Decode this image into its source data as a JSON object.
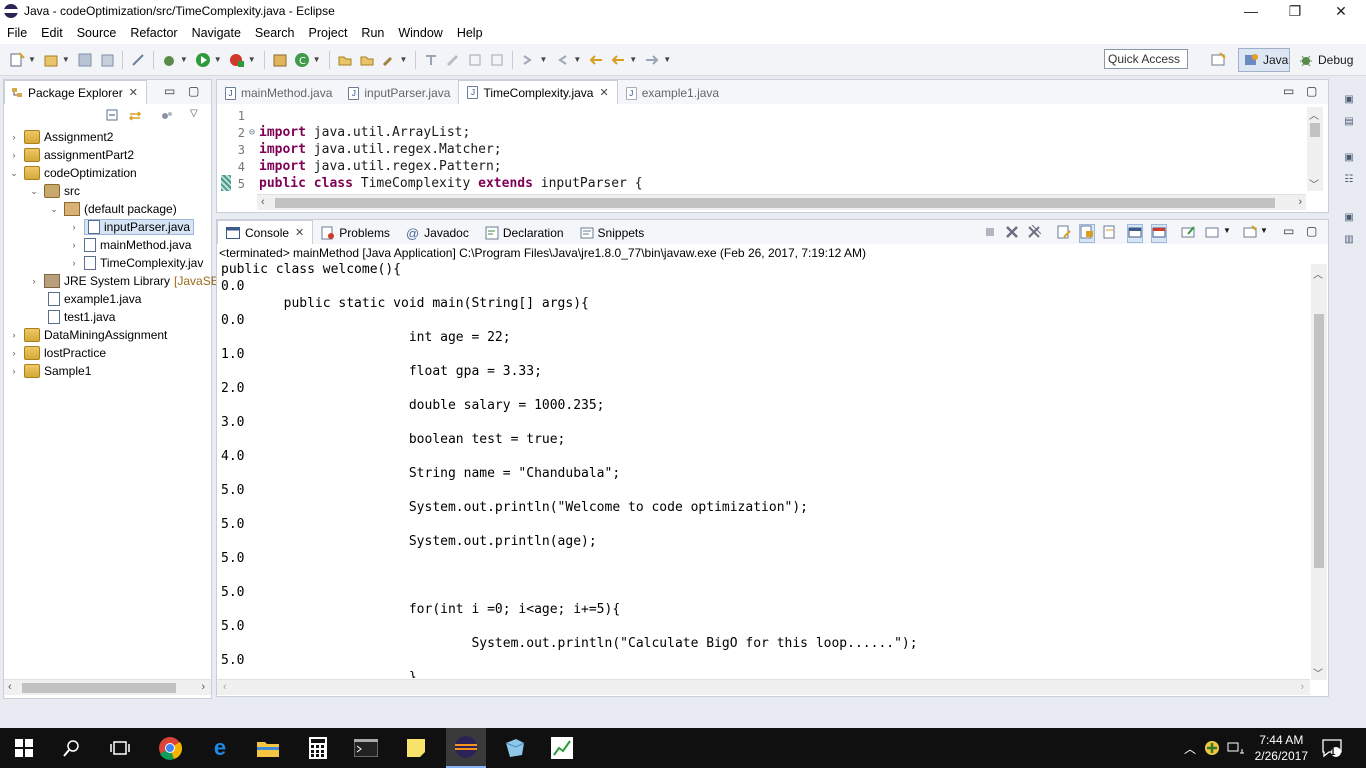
{
  "window": {
    "title": "Java - codeOptimization/src/TimeComplexity.java - Eclipse",
    "minimize": "—",
    "maximize": "❐",
    "close": "✕"
  },
  "menu": [
    "File",
    "Edit",
    "Source",
    "Refactor",
    "Navigate",
    "Search",
    "Project",
    "Run",
    "Window",
    "Help"
  ],
  "toolbar": {
    "quick_access": "Quick Access",
    "perspective_java": "Java",
    "perspective_debug": "Debug"
  },
  "package_explorer": {
    "tab_label": "Package Explorer",
    "items": [
      {
        "label": "Assignment2",
        "icon": "project-icon"
      },
      {
        "label": "assignmentPart2",
        "icon": "project-icon"
      },
      {
        "label": "codeOptimization",
        "icon": "project-icon"
      },
      {
        "label": "src",
        "icon": "source-folder-icon"
      },
      {
        "label": "(default package)",
        "icon": "package-icon"
      },
      {
        "label": "inputParser.java",
        "icon": "java-file-icon"
      },
      {
        "label": "mainMethod.java",
        "icon": "java-file-icon"
      },
      {
        "label": "TimeComplexity.jav",
        "icon": "java-file-icon"
      },
      {
        "label": "JRE System Library",
        "decoration": "[JavaSE-",
        "icon": "library-icon"
      },
      {
        "label": "example1.java",
        "icon": "java-file-icon"
      },
      {
        "label": "test1.java",
        "icon": "java-file-icon"
      },
      {
        "label": "DataMiningAssignment",
        "icon": "project-icon"
      },
      {
        "label": "lostPractice",
        "icon": "project-icon"
      },
      {
        "label": "Sample1",
        "icon": "project-icon"
      }
    ]
  },
  "editor": {
    "tabs": [
      {
        "label": "mainMethod.java",
        "active": false
      },
      {
        "label": "inputParser.java",
        "active": false
      },
      {
        "label": "TimeComplexity.java",
        "active": true
      },
      {
        "label": "example1.java",
        "active": false
      }
    ],
    "lines": [
      {
        "num": "1",
        "kw": "",
        "text": ""
      },
      {
        "num": "2",
        "kw": "import",
        "text": " java.util.ArrayList;"
      },
      {
        "num": "3",
        "kw": "import",
        "text": " java.util.regex.Matcher;"
      },
      {
        "num": "4",
        "kw": "import",
        "text": " java.util.regex.Pattern;"
      },
      {
        "num": "5",
        "kw": "public class",
        "text": " TimeComplexity ",
        "kw2": "extends",
        "text2": " inputParser {"
      }
    ]
  },
  "console": {
    "tabs": [
      {
        "label": "Console",
        "active": true
      },
      {
        "label": "Problems",
        "active": false
      },
      {
        "label": "Javadoc",
        "active": false
      },
      {
        "label": "Declaration",
        "active": false
      },
      {
        "label": "Snippets",
        "active": false
      }
    ],
    "status": "<terminated> mainMethod [Java Application] C:\\Program Files\\Java\\jre1.8.0_77\\bin\\javaw.exe (Feb 26, 2017, 7:19:12 AM)",
    "lines": [
      "public class welcome(){",
      "0.0",
      "        public static void main(String[] args){",
      "0.0",
      "                        int age = 22;",
      "1.0",
      "                        float gpa = 3.33;",
      "2.0",
      "                        double salary = 1000.235;",
      "3.0",
      "                        boolean test = true;",
      "4.0",
      "                        String name = \"Chandubala\";",
      "5.0",
      "                        System.out.println(\"Welcome to code optimization\");",
      "5.0",
      "                        System.out.println(age);",
      "5.0",
      "",
      "5.0",
      "                        for(int i =0; i<age; i+=5){",
      "5.0",
      "                                System.out.println(\"Calculate BigO for this loop......\");",
      "5.0",
      "                        }"
    ]
  },
  "taskbar": {
    "time": "7:44 AM",
    "date": "2/26/2017",
    "notification_count": "1"
  }
}
